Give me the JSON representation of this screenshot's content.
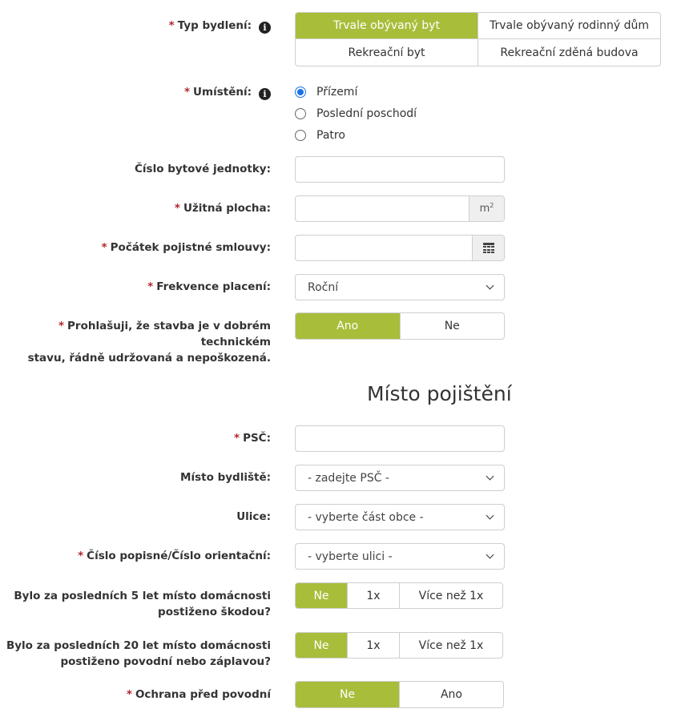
{
  "required_mark": "*",
  "info_icon_glyph": "i",
  "colors": {
    "accent": "#a8bd3a",
    "required": "#b0272d",
    "radio": "#1a73e8"
  },
  "typ_bydleni": {
    "label": "Typ bydlení:",
    "options": [
      "Trvale obývaný byt",
      "Trvale obývaný rodinný dům",
      "Rekreační byt",
      "Rekreační zděná budova"
    ],
    "selected": "Trvale obývaný byt"
  },
  "umisteni": {
    "label": "Umístění:",
    "options": [
      "Přízemí",
      "Poslední poschodí",
      "Patro"
    ],
    "selected": "Přízemí"
  },
  "cislo_jednotky": {
    "label": "Číslo bytové jednotky:",
    "value": ""
  },
  "uzitna_plocha": {
    "label": "Užitná plocha:",
    "value": "",
    "unit": "m",
    "unit_sup": "2"
  },
  "pocatek": {
    "label": "Počátek pojistné smlouvy:",
    "value": "",
    "icon": "calendar-icon"
  },
  "frekvence": {
    "label": "Frekvence placení:",
    "selected": "Roční"
  },
  "prohlaseni": {
    "label_line1": "Prohlašuji, že stavba je v dobrém technickém",
    "label_line2": "stavu, řádně udržovaná a nepoškozená.",
    "options": [
      "Ano",
      "Ne"
    ],
    "selected": "Ano"
  },
  "section_title": "Místo pojištění",
  "psc": {
    "label": "PSČ:",
    "value": ""
  },
  "misto_bydliste": {
    "label": "Místo bydliště:",
    "selected": "- zadejte PSČ -"
  },
  "ulice": {
    "label": "Ulice:",
    "selected": "- vyberte část obce -"
  },
  "cislo_popisne": {
    "label": "Číslo popisné/Číslo orientační:",
    "selected": "- vyberte ulici -"
  },
  "skoda5": {
    "label_line1": "Bylo za posledních 5 let místo domácnosti",
    "label_line2": "postiženo škodou?",
    "options": [
      "Ne",
      "1x",
      "Více než 1x"
    ],
    "selected": "Ne"
  },
  "povoden20": {
    "label_line1": "Bylo za posledních 20 let místo domácnosti",
    "label_line2": "postiženo povodní nebo záplavou?",
    "options": [
      "Ne",
      "1x",
      "Více než 1x"
    ],
    "selected": "Ne"
  },
  "ochrana": {
    "label": "Ochrana před povodní",
    "options": [
      "Ne",
      "Ano"
    ],
    "selected": "Ne"
  }
}
